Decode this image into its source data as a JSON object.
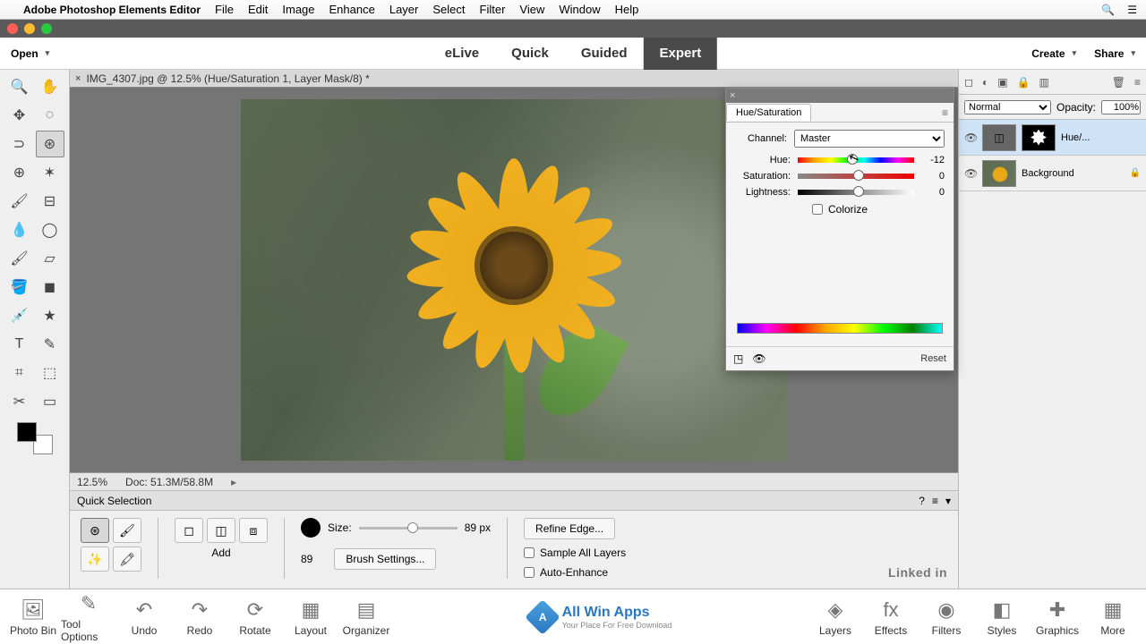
{
  "menubar": {
    "app_title": "Adobe Photoshop Elements Editor",
    "items": [
      "File",
      "Edit",
      "Image",
      "Enhance",
      "Layer",
      "Select",
      "Filter",
      "View",
      "Window",
      "Help"
    ]
  },
  "mode_bar": {
    "open": "Open",
    "tabs": [
      "eLive",
      "Quick",
      "Guided",
      "Expert"
    ],
    "active_tab": "Expert",
    "create": "Create",
    "share": "Share"
  },
  "document": {
    "tab_label": "IMG_4307.jpg @ 12.5% (Hue/Saturation 1, Layer Mask/8) *",
    "zoom": "12.5%",
    "doc_size": "Doc: 51.3M/58.8M"
  },
  "options": {
    "tool_name": "Quick Selection",
    "add_label": "Add",
    "size_label": "Size:",
    "size_value": "89",
    "size_px": "89 px",
    "brush_settings": "Brush Settings...",
    "refine_edge": "Refine Edge...",
    "sample_all": "Sample All Layers",
    "auto_enhance": "Auto-Enhance"
  },
  "layers_panel": {
    "blend_mode": "Normal",
    "opacity_label": "Opacity:",
    "opacity_value": "100%",
    "layer1_name": "Hue/...",
    "layer2_name": "Background"
  },
  "hue_sat": {
    "title": "Hue/Saturation",
    "channel_label": "Channel:",
    "channel_value": "Master",
    "hue_label": "Hue:",
    "hue_value": "-12",
    "saturation_label": "Saturation:",
    "saturation_value": "0",
    "lightness_label": "Lightness:",
    "lightness_value": "0",
    "colorize": "Colorize",
    "reset": "Reset"
  },
  "bottom_bar": {
    "left": [
      "Photo Bin",
      "Tool Options",
      "Undo",
      "Redo",
      "Rotate",
      "Layout",
      "Organizer"
    ],
    "right": [
      "Layers",
      "Effects",
      "Filters",
      "Styles",
      "Graphics",
      "More"
    ],
    "center_brand": "All Win Apps",
    "center_sub": "Your Place For Free Download",
    "linkedin": "Linked in"
  }
}
